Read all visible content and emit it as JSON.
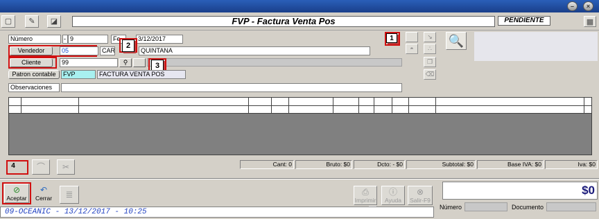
{
  "titlebar": {
    "minimize": "–",
    "close": "×"
  },
  "toolbar": {
    "doc_title": "FVP - Factura Venta Pos",
    "status": "PENDIENTE"
  },
  "form": {
    "numero_label": "Número",
    "numero_prefix": "-",
    "numero_value": "9",
    "fecha_label": "Fe",
    "fecha_value": "3/12/2017",
    "vendedor_label": "Vendedor",
    "vendedor_code": "05",
    "vendedor_name_a": "CARL",
    "vendedor_name_b": "QUINTANA",
    "cliente_label": "Cliente",
    "cliente_code": "99",
    "patron_label": "Patron contable",
    "patron_code": "FVP",
    "patron_desc": "FACTURA VENTA POS",
    "observaciones_label": "Observaciones",
    "observaciones_value": ""
  },
  "callouts": [
    "1",
    "2",
    "3",
    "4"
  ],
  "totals": {
    "cant": "Cant: 0",
    "bruto": "Bruto: $0",
    "dcto": "Dcto: - $0",
    "subtotal": "Subtotal: $0",
    "base_iva": "Base IVA: $0",
    "iva": "Iva: $0"
  },
  "bottom": {
    "aceptar": "Aceptar",
    "cerrar": "Cerrar",
    "imprimir": "Imprimir",
    "ayuda": "Ayuda",
    "salir": "Salir-F9",
    "total": "$0",
    "numero_label": "Número",
    "documento_label": "Documento"
  },
  "statusbar": {
    "text": "09-OCEANIC - 13/12/2017 - 10:25"
  },
  "icons": {
    "search": "magnifier-icon",
    "aceptar": "check-circle-icon",
    "cerrar": "undo-arrow-icon"
  },
  "colors": {
    "callout_border": "#d01010",
    "title_bar": "#2a5fb8",
    "status_text": "#2040c0"
  }
}
